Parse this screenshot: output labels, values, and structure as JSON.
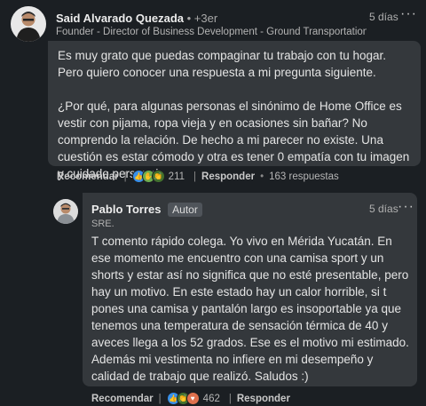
{
  "comment1": {
    "author": "Said Alvarado Quezada",
    "degree": "• +3er",
    "headline": "Founder - Director of Business Development - Ground Transportation P...",
    "time": "5 días",
    "paragraph1": "Es muy grato que puedas compaginar tu trabajo con tu hogar. Pero quiero conocer una respuesta a mi pregunta siguiente.",
    "paragraph2": "¿Por qué, para algunas personas el sinónimo de Home Office es vestir con pijama, ropa vieja y en ocasiones sin bañar? No comprendo la relación. De hecho a mi parecer no existe. Una cuestión es estar cómodo y otra es tener 0 empatía con tu imagen y cuidado personal.",
    "actions": {
      "like_label": "Recomendar",
      "separator": "|",
      "reaction_count": "211",
      "reply_label": "Responder",
      "dot": "•",
      "replies_count": "163 respuestas"
    },
    "reactions": [
      "like-icon",
      "support-icon",
      "celebrate-icon"
    ]
  },
  "comment2": {
    "author": "Pablo Torres",
    "badge": "Autor",
    "headline": "SRE.",
    "time": "5 días",
    "text": "T comento rápido colega. Yo vivo en Mérida Yucatán. En ese momento me encuentro con una camisa sport y un shorts y estar así no significa que no esté presentable, pero hay un motivo. En este estado hay un calor horrible, si t pones una camisa y pantalón largo es insoportable ya que tenemos una temperatura de sensación térmica de 40 y aveces llega a los 52 grados. Ese es el motivo mi estimado. Además mi vestimenta no infiere en mi desempeño y calidad de trabajo que realizó. Saludos :)",
    "actions": {
      "like_label": "Recomendar",
      "separator": "|",
      "reaction_count": "462",
      "reply_label": "Responder"
    },
    "reactions": [
      "like-icon",
      "celebrate-icon",
      "love-icon"
    ]
  },
  "more_glyph": "···"
}
